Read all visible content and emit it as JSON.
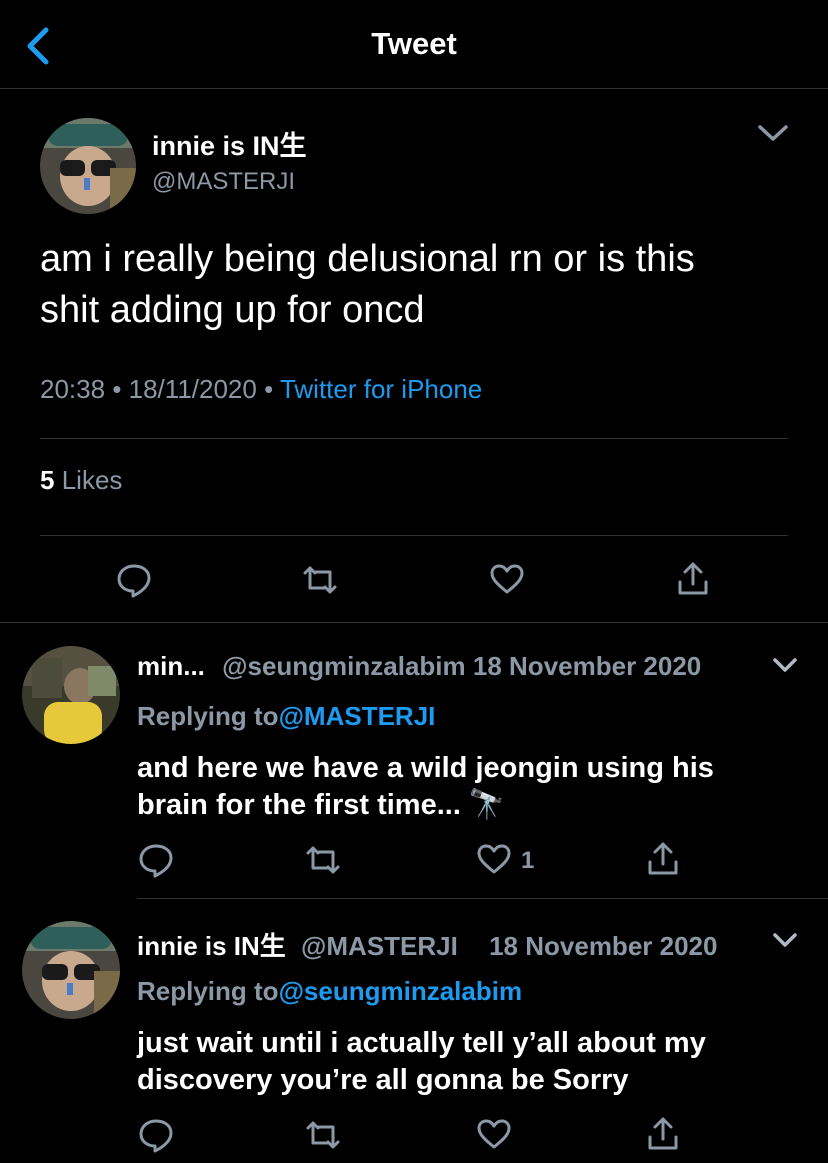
{
  "header": {
    "title": "Tweet",
    "back_icon": "chevron-left-icon",
    "accent": "#1d9bf0"
  },
  "tweet": {
    "author": {
      "name": "innie is IN生",
      "handle": "@MASTERJI"
    },
    "text_line1": "am i really being delusional rn or is this",
    "text_line2": "shit adding up for oncd",
    "time": "20:38",
    "date": "18/11/2020",
    "source": "Twitter for iPhone",
    "likes_count": "5",
    "likes_label": "Likes",
    "actions": [
      "comment-icon",
      "retweet-icon",
      "heart-icon",
      "share-icon"
    ]
  },
  "replies": [
    {
      "name": "min...",
      "handle": "@seungminzalabim",
      "date": "18 November 2020",
      "replying_label": "Replying to",
      "replying_to": "@MASTERJI",
      "text_line1": "and here we have a wild jeongin using his",
      "text_line2": "brain for the first time... 🔭",
      "like_count": "1"
    },
    {
      "name": "innie is IN生",
      "handle": "@MASTERJI",
      "date": "18 November 2020",
      "replying_label": "Replying to",
      "replying_to": "@seungminzalabim",
      "text_line1": "just wait until i actually tell y’all about my",
      "text_line2": "discovery you’re all gonna be Sorry",
      "like_count": ""
    }
  ]
}
